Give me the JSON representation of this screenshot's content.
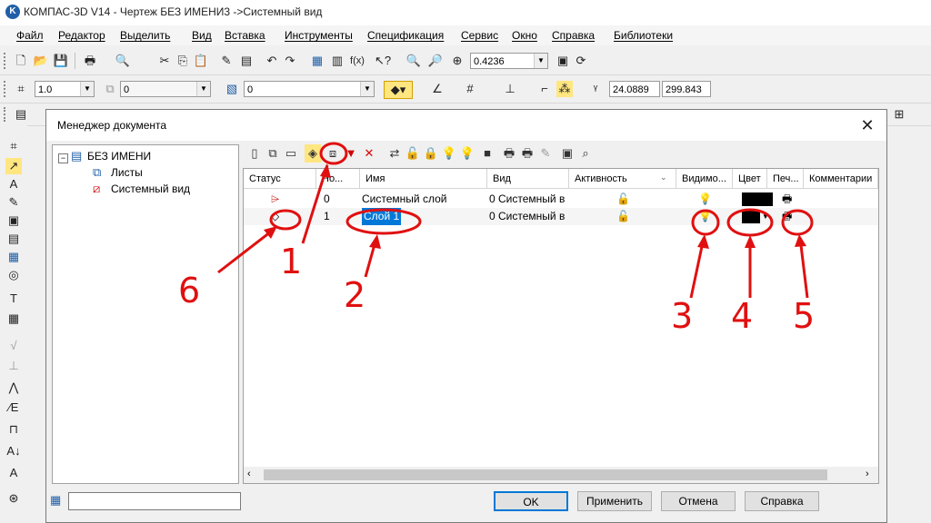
{
  "window": {
    "title": "КОМПАС-3D V14 - Чертеж БЕЗ ИМЕНИ3 ->Системный вид",
    "logo_letter": "K"
  },
  "menu": [
    "Файл",
    "Редактор",
    "Выделить",
    "Вид",
    "Вставка",
    "Инструменты",
    "Спецификация",
    "Сервис",
    "Окно",
    "Справка",
    "Библиотеки"
  ],
  "toolbar1": {
    "zoom_value": "0.4236"
  },
  "toolbar2": {
    "line_scale": "1.0",
    "layer_value": "0",
    "state_value": "0",
    "coord_x": "24.0889",
    "coord_y": "299.843"
  },
  "dialog": {
    "title": "Менеджер документа",
    "close_glyph": "✕",
    "tree": {
      "root": "БЕЗ ИМЕНИ",
      "sheets": "Листы",
      "view": "Системный вид"
    },
    "columns": [
      "Статус",
      "Но...",
      "Имя",
      "Вид",
      "Активность",
      "Видимо...",
      "Цвет",
      "Печ...",
      "Комментарии"
    ],
    "rows": [
      {
        "number": "0",
        "name": "Системный слой",
        "view": "0 Системный в",
        "color": "#000000"
      },
      {
        "number": "1",
        "name": "Слой 1",
        "view": "0 Системный в",
        "color": "#000000"
      }
    ],
    "buttons": {
      "ok": "OK",
      "apply": "Применить",
      "cancel": "Отмена",
      "help": "Справка"
    }
  },
  "annotations": [
    "1",
    "2",
    "3",
    "4",
    "5",
    "6"
  ],
  "colors": {
    "annotation": "#e01010",
    "selection": "#0078d7"
  }
}
